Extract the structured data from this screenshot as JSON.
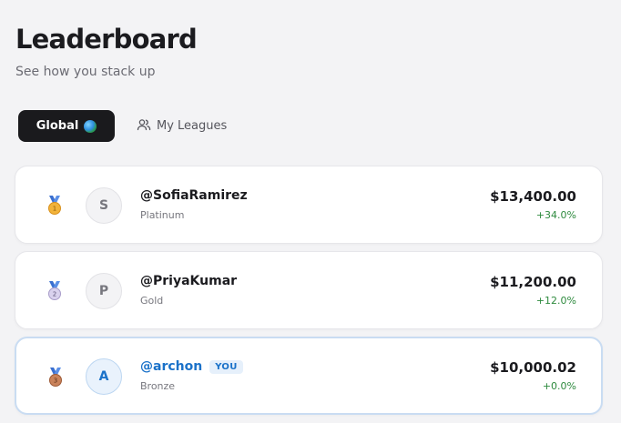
{
  "header": {
    "title": "Leaderboard",
    "subtitle": "See how you stack up"
  },
  "tabs": [
    {
      "label": "Global",
      "icon": "globe-icon",
      "active": true
    },
    {
      "label": "My Leagues",
      "icon": "users-icon",
      "active": false
    }
  ],
  "entries": [
    {
      "rank": 1,
      "medal": "gold-medal-icon",
      "initial": "S",
      "username": "@SofiaRamirez",
      "tier": "Platinum",
      "amount": "$13,400.00",
      "change": "+34.0%",
      "is_you": false
    },
    {
      "rank": 2,
      "medal": "silver-medal-icon",
      "initial": "P",
      "username": "@PriyaKumar",
      "tier": "Gold",
      "amount": "$11,200.00",
      "change": "+12.0%",
      "is_you": false
    },
    {
      "rank": 3,
      "medal": "bronze-medal-icon",
      "initial": "A",
      "username": "@archon",
      "tier": "Bronze",
      "amount": "$10,000.02",
      "change": "+0.0%",
      "is_you": true,
      "you_badge": "YOU"
    }
  ],
  "colors": {
    "accent_blue": "#1b72c9",
    "positive_green": "#2e8a3e",
    "active_tab_bg": "#1a1a1d"
  }
}
